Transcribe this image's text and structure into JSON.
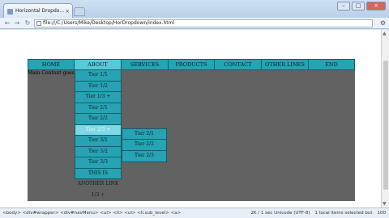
{
  "browser": {
    "tab_title": "Horizontal Dropdo...",
    "address": "file:///C:/Users/Mike/Desktop/HorDropdown/index.html",
    "back_glyph": "←",
    "forward_glyph": "→",
    "reload_glyph": "↻",
    "wrench_glyph": "⚙",
    "window_buttons": {
      "minimize": "–",
      "maximize": "□",
      "close": "×"
    },
    "tab_close": "×"
  },
  "nav": {
    "items": [
      {
        "label": "HOME"
      },
      {
        "label": "ABOUT"
      },
      {
        "label": "SERVICES"
      },
      {
        "label": "PRODUCTS"
      },
      {
        "label": "CONTACT"
      },
      {
        "label": "OTHER LINKS"
      },
      {
        "label": "END"
      }
    ]
  },
  "content": {
    "text": "Main Content goes h"
  },
  "dropdown": {
    "items": [
      {
        "label": "Tier 1/1"
      },
      {
        "label": "Tier 1/2"
      },
      {
        "label": "Tier 1/3 +"
      },
      {
        "label": "Tier 2/1"
      },
      {
        "label": "Tier 2/2"
      },
      {
        "label": "Tier 2/3 +"
      },
      {
        "label": "Tier 3/1"
      },
      {
        "label": "Tier 3/2"
      },
      {
        "label": "Tier 3/3"
      },
      {
        "label": "THIS IS"
      }
    ],
    "overflow_lines": [
      "ANOTHER LINK",
      "1/3 +"
    ]
  },
  "submenu": {
    "items": [
      {
        "label": "Tier 2/1"
      },
      {
        "label": "Tier 2/2"
      },
      {
        "label": "Tier 2/3"
      }
    ]
  },
  "statusbar": {
    "path": "<body> <div#wrapper> <div#navMenu> <ul> <li> <ul> <li.sub_level> <a>",
    "stats": "2K / 1 sec Unicode (UTF-8)",
    "selection": "1 local items selected but",
    "zoom": "100"
  },
  "colors": {
    "menu_bg": "#27a3b3",
    "menu_active": "#56cad9",
    "menu_hover": "#7fd8e3",
    "wrapper_bg": "#626262"
  }
}
